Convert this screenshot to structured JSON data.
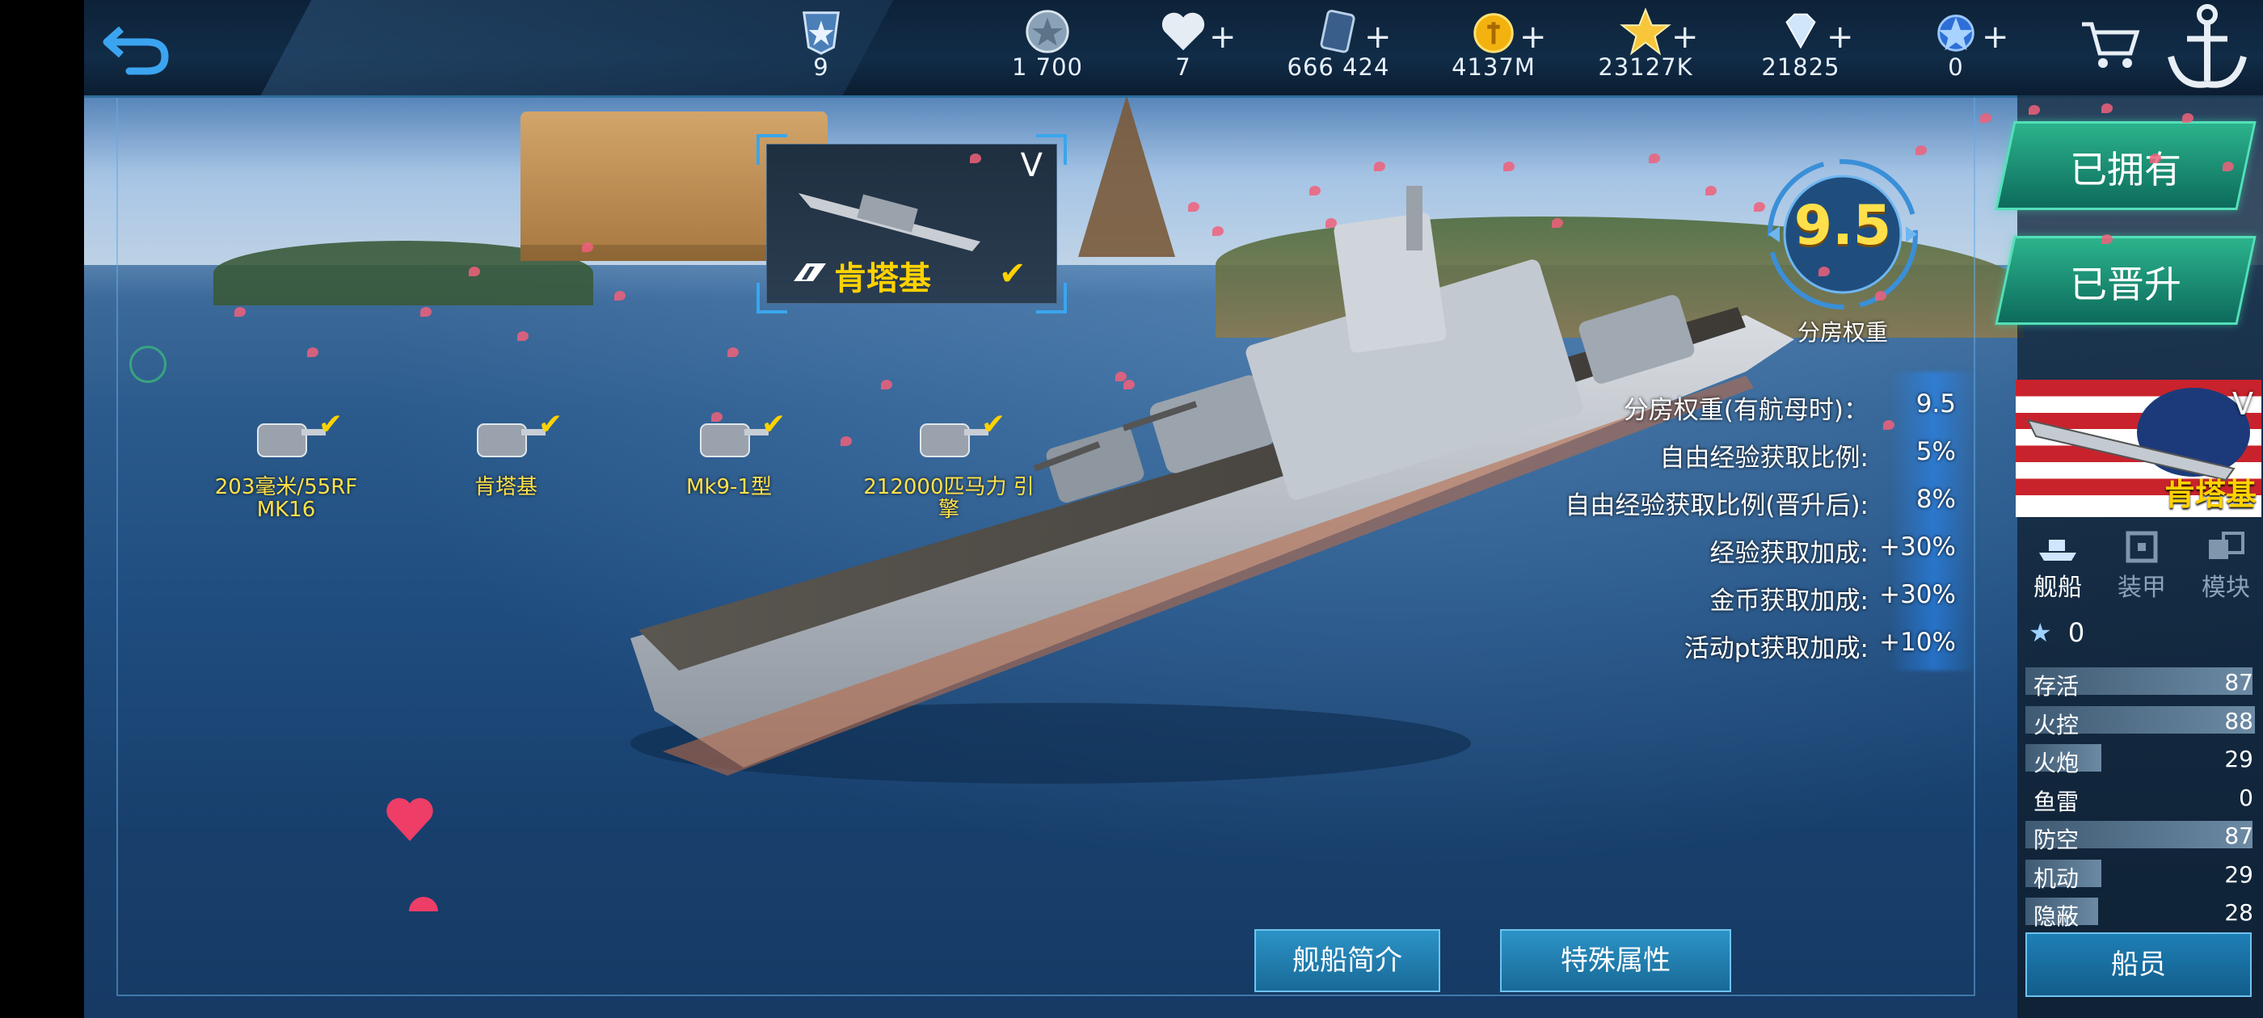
{
  "hud": {
    "resources": [
      {
        "name": "rank",
        "icon": "rank-shield-icon",
        "value": "9",
        "plus": false
      },
      {
        "name": "silver",
        "icon": "silver-coin-icon",
        "value": "1 700",
        "plus": false
      },
      {
        "name": "hearts",
        "icon": "heart-icon",
        "value": "7",
        "plus": true
      },
      {
        "name": "cards",
        "icon": "card-icon",
        "value": "666 424",
        "plus": true
      },
      {
        "name": "gold",
        "icon": "gold-coin-icon",
        "value": "4137M",
        "plus": true
      },
      {
        "name": "stars",
        "icon": "star-icon",
        "value": "23127K",
        "plus": true
      },
      {
        "name": "diamonds",
        "icon": "diamond-icon",
        "value": "21825",
        "plus": true
      },
      {
        "name": "badge",
        "icon": "blue-badge-icon",
        "value": "0",
        "plus": true
      }
    ]
  },
  "selected_ship": {
    "tier": "V",
    "name": "肯塔基"
  },
  "equipment": [
    {
      "label": "203毫米/55RF MK16",
      "checked": true
    },
    {
      "label": "肯塔基",
      "checked": true
    },
    {
      "label": "Mk9-1型",
      "checked": true
    },
    {
      "label": "212000匹马力 引擎",
      "checked": true
    }
  ],
  "weight": {
    "value": "9.5",
    "label": "分房权重"
  },
  "stats": [
    {
      "label": "分房权重(有航母时)：",
      "value": "9.5"
    },
    {
      "label": "自由经验获取比例:",
      "value": "5%"
    },
    {
      "label": "自由经验获取比例(晋升后):",
      "value": "8%"
    },
    {
      "label": "经验获取加成:",
      "value": "+30%"
    },
    {
      "label": "金币获取加成:",
      "value": "+30%"
    },
    {
      "label": "活动pt获取加成:",
      "value": "+10%"
    }
  ],
  "right_panel": {
    "owned_label": "已拥有",
    "promoted_label": "已晋升",
    "portrait": {
      "tier": "V",
      "name": "肯塔基"
    },
    "tabs": [
      {
        "label": "舰船",
        "icon": "ship-icon",
        "active": true
      },
      {
        "label": "装甲",
        "icon": "armor-icon",
        "active": false
      },
      {
        "label": "模块",
        "icon": "module-icon",
        "active": false
      }
    ],
    "star_count": "0",
    "attributes": [
      {
        "label": "存活",
        "value": 87
      },
      {
        "label": "火控",
        "value": 88
      },
      {
        "label": "火炮",
        "value": 29
      },
      {
        "label": "鱼雷",
        "value": 0
      },
      {
        "label": "防空",
        "value": 87
      },
      {
        "label": "机动",
        "value": 29
      },
      {
        "label": "隐蔽",
        "value": 28
      }
    ],
    "crew_label": "船员"
  },
  "bottom_buttons": {
    "intro_label": "舰船简介",
    "special_label": "特殊属性"
  },
  "colors": {
    "accent_gold": "#ffd200",
    "accent_blue": "#39a6ee",
    "teal_button": "#1a8f76"
  }
}
